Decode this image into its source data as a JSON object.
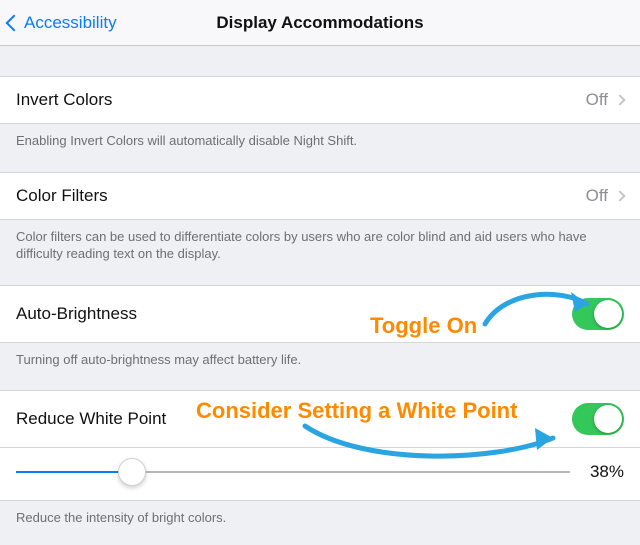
{
  "nav": {
    "back_label": "Accessibility",
    "title": "Display Accommodations"
  },
  "rows": {
    "invert": {
      "label": "Invert Colors",
      "value": "Off",
      "footer": "Enabling Invert Colors will automatically disable Night Shift."
    },
    "filters": {
      "label": "Color Filters",
      "value": "Off",
      "footer": "Color filters can be used to differentiate colors by users who are color blind and aid users who have difficulty reading text on the display."
    },
    "auto_brightness": {
      "label": "Auto-Brightness",
      "on": true,
      "footer": "Turning off auto-brightness may affect battery life."
    },
    "reduce_white_point": {
      "label": "Reduce White Point",
      "on": true,
      "percent": 38,
      "percent_text": "38%",
      "footer": "Reduce the intensity of bright colors."
    }
  },
  "annotations": {
    "toggle_on": "Toggle On",
    "consider": "Consider Setting a White Point"
  },
  "colors": {
    "accent_blue": "#0a7aff",
    "switch_green": "#34c759",
    "anno_orange": "#ff8a00",
    "arrow_blue": "#2aa5e1"
  }
}
